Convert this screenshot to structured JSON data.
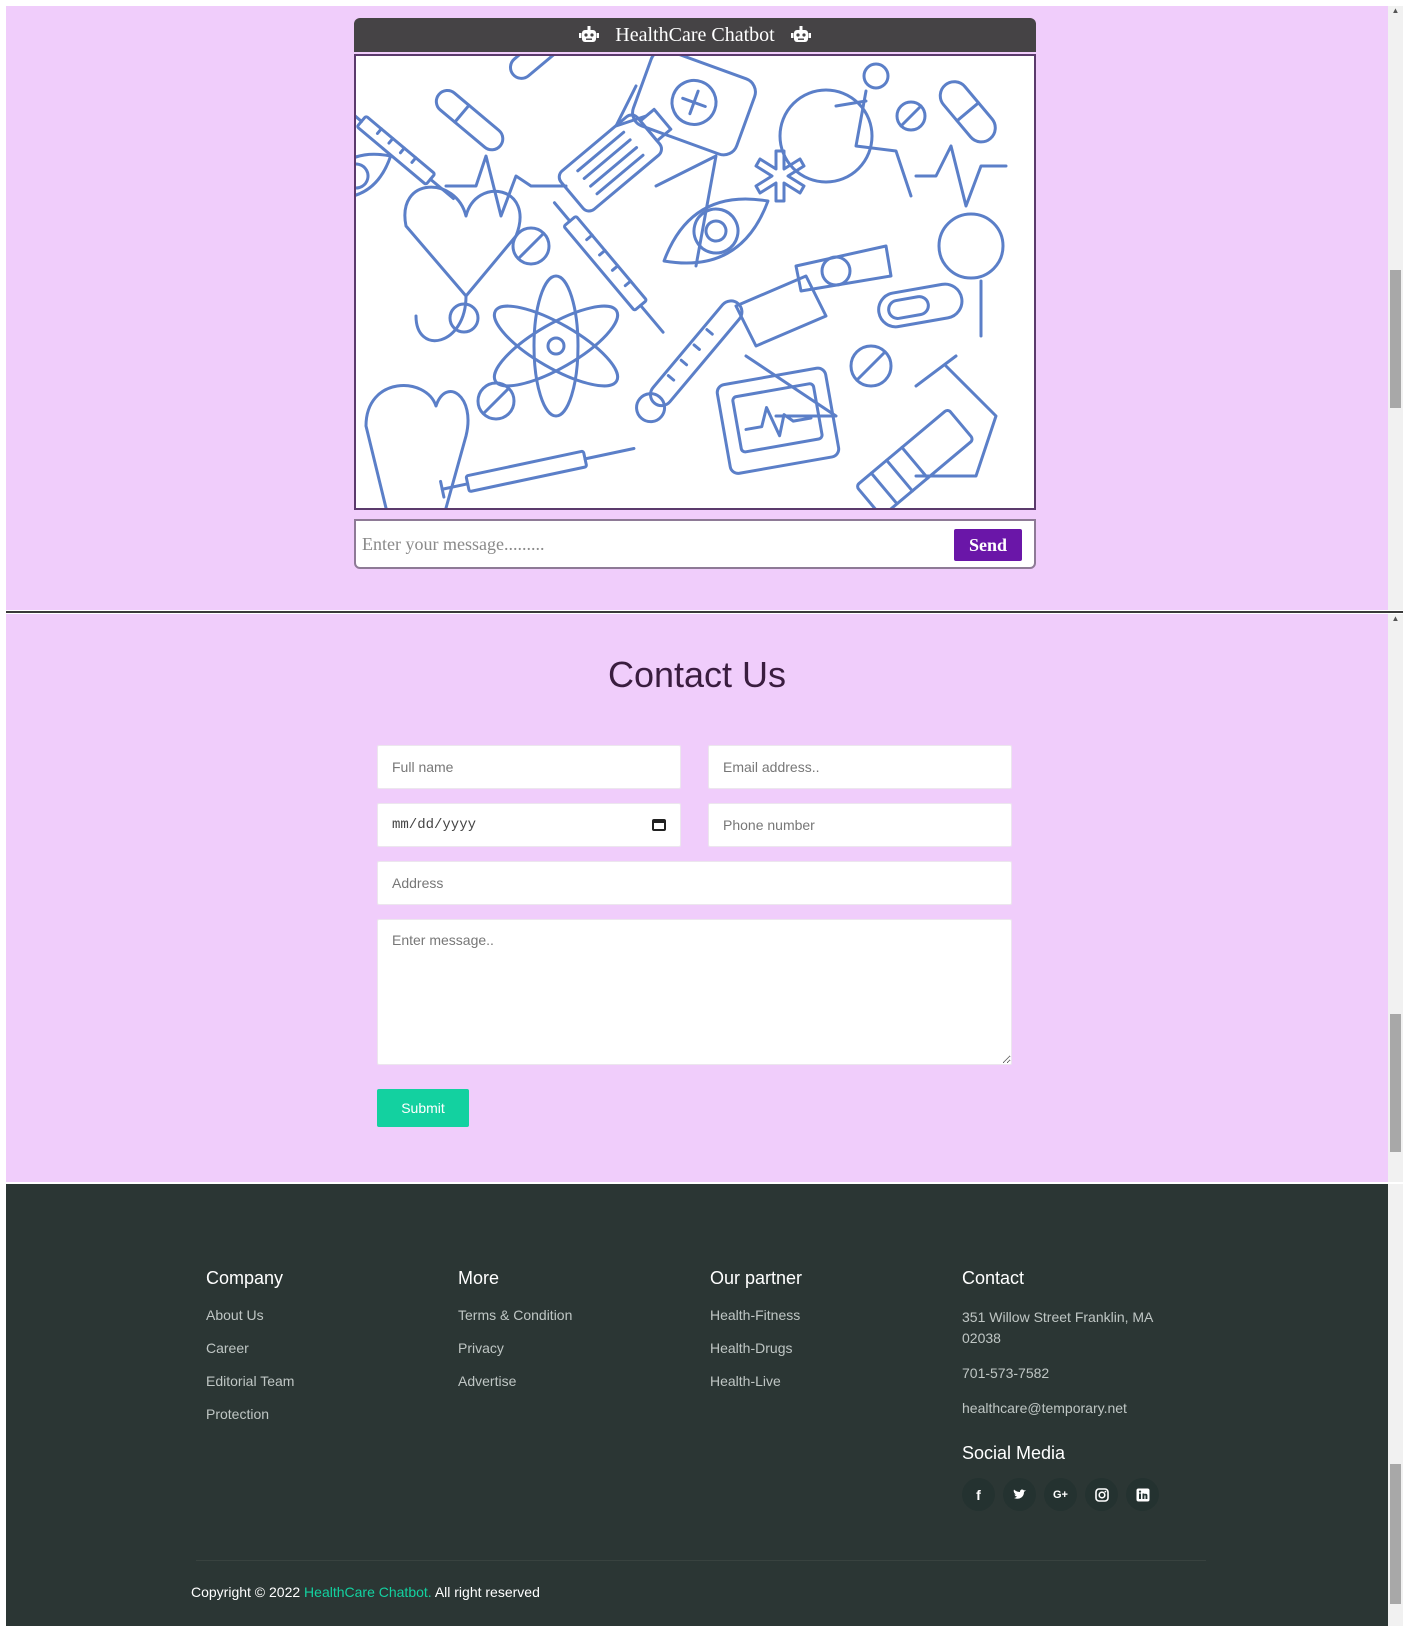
{
  "chatbot": {
    "title": "HealthCare Chatbot",
    "input_placeholder": "Enter your message.........",
    "send_label": "Send"
  },
  "contact": {
    "title": "Contact Us",
    "full_name_placeholder": "Full name",
    "email_placeholder": "Email address..",
    "date_placeholder": "mm/dd/yyyy",
    "phone_placeholder": "Phone number",
    "address_placeholder": "Address",
    "message_placeholder": "Enter message..",
    "submit_label": "Submit"
  },
  "footer": {
    "company": {
      "heading": "Company",
      "links": [
        "About Us",
        "Career",
        "Editorial Team",
        "Protection"
      ]
    },
    "more": {
      "heading": "More",
      "links": [
        "Terms & Condition",
        "Privacy",
        "Advertise"
      ]
    },
    "partner": {
      "heading": "Our partner",
      "links": [
        "Health-Fitness",
        "Health-Drugs",
        "Health-Live"
      ]
    },
    "contact": {
      "heading": "Contact",
      "address": "351 Willow Street Franklin, MA 02038",
      "phone": "701-573-7582",
      "email": "healthcare@temporary.net"
    },
    "social_heading": "Social Media",
    "social_icons": [
      "facebook-icon",
      "twitter-icon",
      "google-plus-icon",
      "instagram-icon",
      "linkedin-icon"
    ],
    "copyright_prefix": "Copyright © 2022",
    "copyright_brand": "HealthCare Chatbot.",
    "copyright_suffix": "All right reserved"
  },
  "colors": {
    "panel_bg": "#f0cdfb",
    "chat_header": "#454345",
    "send_button": "#6a16a8",
    "submit_button": "#13d1a0",
    "footer_bg": "#2b3634",
    "pattern_stroke": "#5b7fc8"
  }
}
